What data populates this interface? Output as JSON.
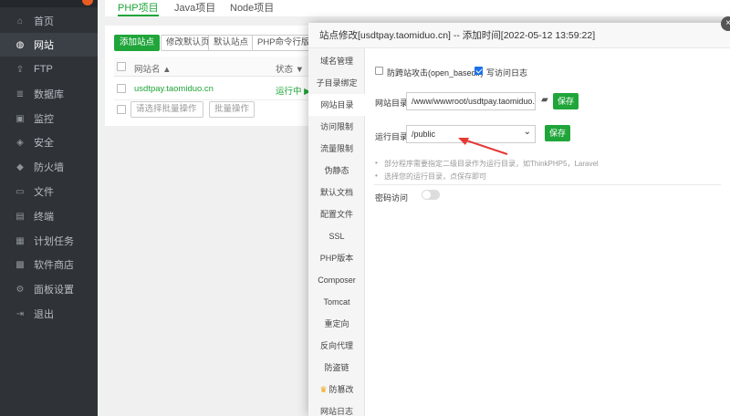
{
  "sidebar": {
    "items": [
      {
        "label": "首页",
        "icon": "home-icon",
        "glyph": "⌂"
      },
      {
        "label": "网站",
        "icon": "globe-icon",
        "glyph": "◍"
      },
      {
        "label": "FTP",
        "icon": "ftp-icon",
        "glyph": "⇪"
      },
      {
        "label": "数据库",
        "icon": "database-icon",
        "glyph": "≣"
      },
      {
        "label": "监控",
        "icon": "monitor-icon",
        "glyph": "▣"
      },
      {
        "label": "安全",
        "icon": "shield-icon",
        "glyph": "◈"
      },
      {
        "label": "防火墙",
        "icon": "firewall-icon",
        "glyph": "◆"
      },
      {
        "label": "文件",
        "icon": "folder-icon",
        "glyph": "▭"
      },
      {
        "label": "终端",
        "icon": "terminal-icon",
        "glyph": "▤"
      },
      {
        "label": "计划任务",
        "icon": "schedule-icon",
        "glyph": "▦"
      },
      {
        "label": "软件商店",
        "icon": "store-icon",
        "glyph": "▩"
      },
      {
        "label": "面板设置",
        "icon": "gear-icon",
        "glyph": "⚙"
      },
      {
        "label": "退出",
        "icon": "logout-icon",
        "glyph": "⇥"
      }
    ]
  },
  "tabs": [
    "PHP项目",
    "Java项目",
    "Node项目"
  ],
  "toolbar": {
    "add_site": "添加站点",
    "edit_default_page": "修改默认页",
    "default_site": "默认站点",
    "php_cli_version": "PHP命令行版本"
  },
  "table": {
    "header_name": "网站名 ▲",
    "header_status": "状态 ▼",
    "row": {
      "name": "usdtpay.taomiduo.cn",
      "status": "运行中 ▶"
    },
    "batch_select": "请选择批量操作",
    "batch_button": "批量操作"
  },
  "dialog": {
    "title": "站点修改[usdtpay.taomiduo.cn] -- 添加时间[2022-05-12 13:59:22]",
    "close_glyph": "×",
    "menu": [
      "域名管理",
      "子目录绑定",
      "网站目录",
      "访问限制",
      "流量限制",
      "伪静态",
      "默认文档",
      "配置文件",
      "SSL",
      "PHP版本",
      "Composer",
      "Tomcat",
      "重定向",
      "反向代理",
      "防盗链",
      "防篡改",
      "网站日志"
    ],
    "anti_xss_label": "防跨站攻击(open_basedir)",
    "access_log_label": "写访问日志",
    "site_dir_label": "网站目录",
    "site_dir_value": "/www/wwwroot/usdtpay.taomiduo.cn",
    "folder_glyph": "▰",
    "save_label": "保存",
    "run_dir_label": "运行目录",
    "run_dir_value": "/public",
    "tip1": "部分程序需要指定二级目录作为运行目录，如ThinkPHP5，Laravel",
    "tip2": "选择您的运行目录，点保存即可",
    "password_access_label": "密码访问",
    "bullet": "•",
    "star_glyph": "♛",
    "dropdown_glyph": "⌄"
  },
  "colors": {
    "accent": "#20a53a",
    "sidebar_bg": "#2f3338",
    "arrow": "#e53935"
  }
}
